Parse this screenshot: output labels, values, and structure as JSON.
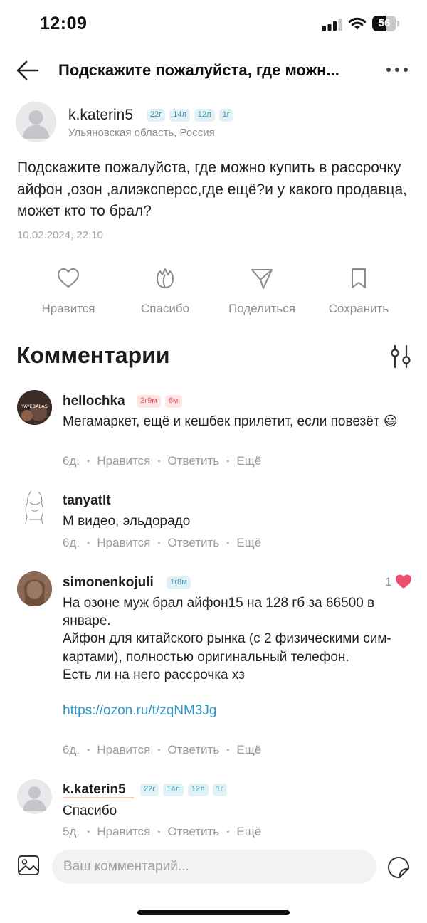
{
  "status_bar": {
    "time": "12:09",
    "battery_level": "56",
    "battery_fraction": 0.56,
    "icons": [
      "signal-icon",
      "wifi-icon",
      "battery-icon"
    ]
  },
  "header": {
    "title": "Подскажите пожалуйста, где можн...",
    "icons": [
      "back-arrow-icon",
      "more-icon"
    ]
  },
  "post": {
    "author": "k.katerin5",
    "badges": [
      "22г",
      "14л",
      "12л",
      "1г"
    ],
    "location": "Ульяновская область, Россия",
    "text": "Подскажите пожалуйста, где можно купить в рассрочку айфон ,озон ,алиэксперсс,где ещё?и у какого продавца, может кто то брал?",
    "date": "10.02.2024, 22:10",
    "actions": [
      {
        "label": "Нравится",
        "icon": "heart-icon"
      },
      {
        "label": "Спасибо",
        "icon": "thanks-flower-icon"
      },
      {
        "label": "Поделиться",
        "icon": "share-icon"
      },
      {
        "label": "Сохранить",
        "icon": "bookmark-icon"
      }
    ]
  },
  "comments_section": {
    "title": "Комментарии",
    "filter_icon": "filter-icon",
    "comments": [
      {
        "author": "hellochka",
        "badges": [
          "2г9м",
          "6м"
        ],
        "avatar_text": "YAYEBALAS",
        "text": "Мегамаркет, ещё и кешбек прилетит, если повезёт 😃",
        "time": "6д.",
        "like_label": "Нравится",
        "reply_label": "Ответить",
        "more_label": "Ещё"
      },
      {
        "author": "tanyatlt",
        "text": "М видео, эльдорадо",
        "time": "6д.",
        "like_label": "Нравится",
        "reply_label": "Ответить",
        "more_label": "Ещё"
      },
      {
        "author": "simonenkojuli",
        "badges": [
          "1г8м"
        ],
        "likes": "1",
        "text_lines": [
          "На озоне муж брал айфон15 на 128 гб за 66500 в январе.",
          "Айфон для китайского рынка (с 2 физическими сим-картами), полностью оригинальный телефон.",
          "Есть ли на него рассрочка хз"
        ],
        "link": "https://ozon.ru/t/zqNM3Jg",
        "time": "6д.",
        "like_label": "Нравится",
        "reply_label": "Ответить",
        "more_label": "Ещё"
      },
      {
        "author": "k.katerin5",
        "badges": [
          "22г",
          "14л",
          "12л",
          "1г"
        ],
        "text": "Спасибо",
        "time": "5д.",
        "like_label": "Нравится",
        "reply_label": "Ответить",
        "more_label": "Ещё"
      }
    ]
  },
  "composer": {
    "placeholder": "Ваш комментарий...",
    "icons": [
      "image-icon",
      "sticker-icon"
    ]
  },
  "colors": {
    "accent_link": "#2c98c6",
    "badge_blue_bg": "#e2f1f6",
    "badge_pink_bg": "#fde3e4",
    "heart_pink": "#ef4f6e",
    "muted_text": "#9a9aa0"
  }
}
